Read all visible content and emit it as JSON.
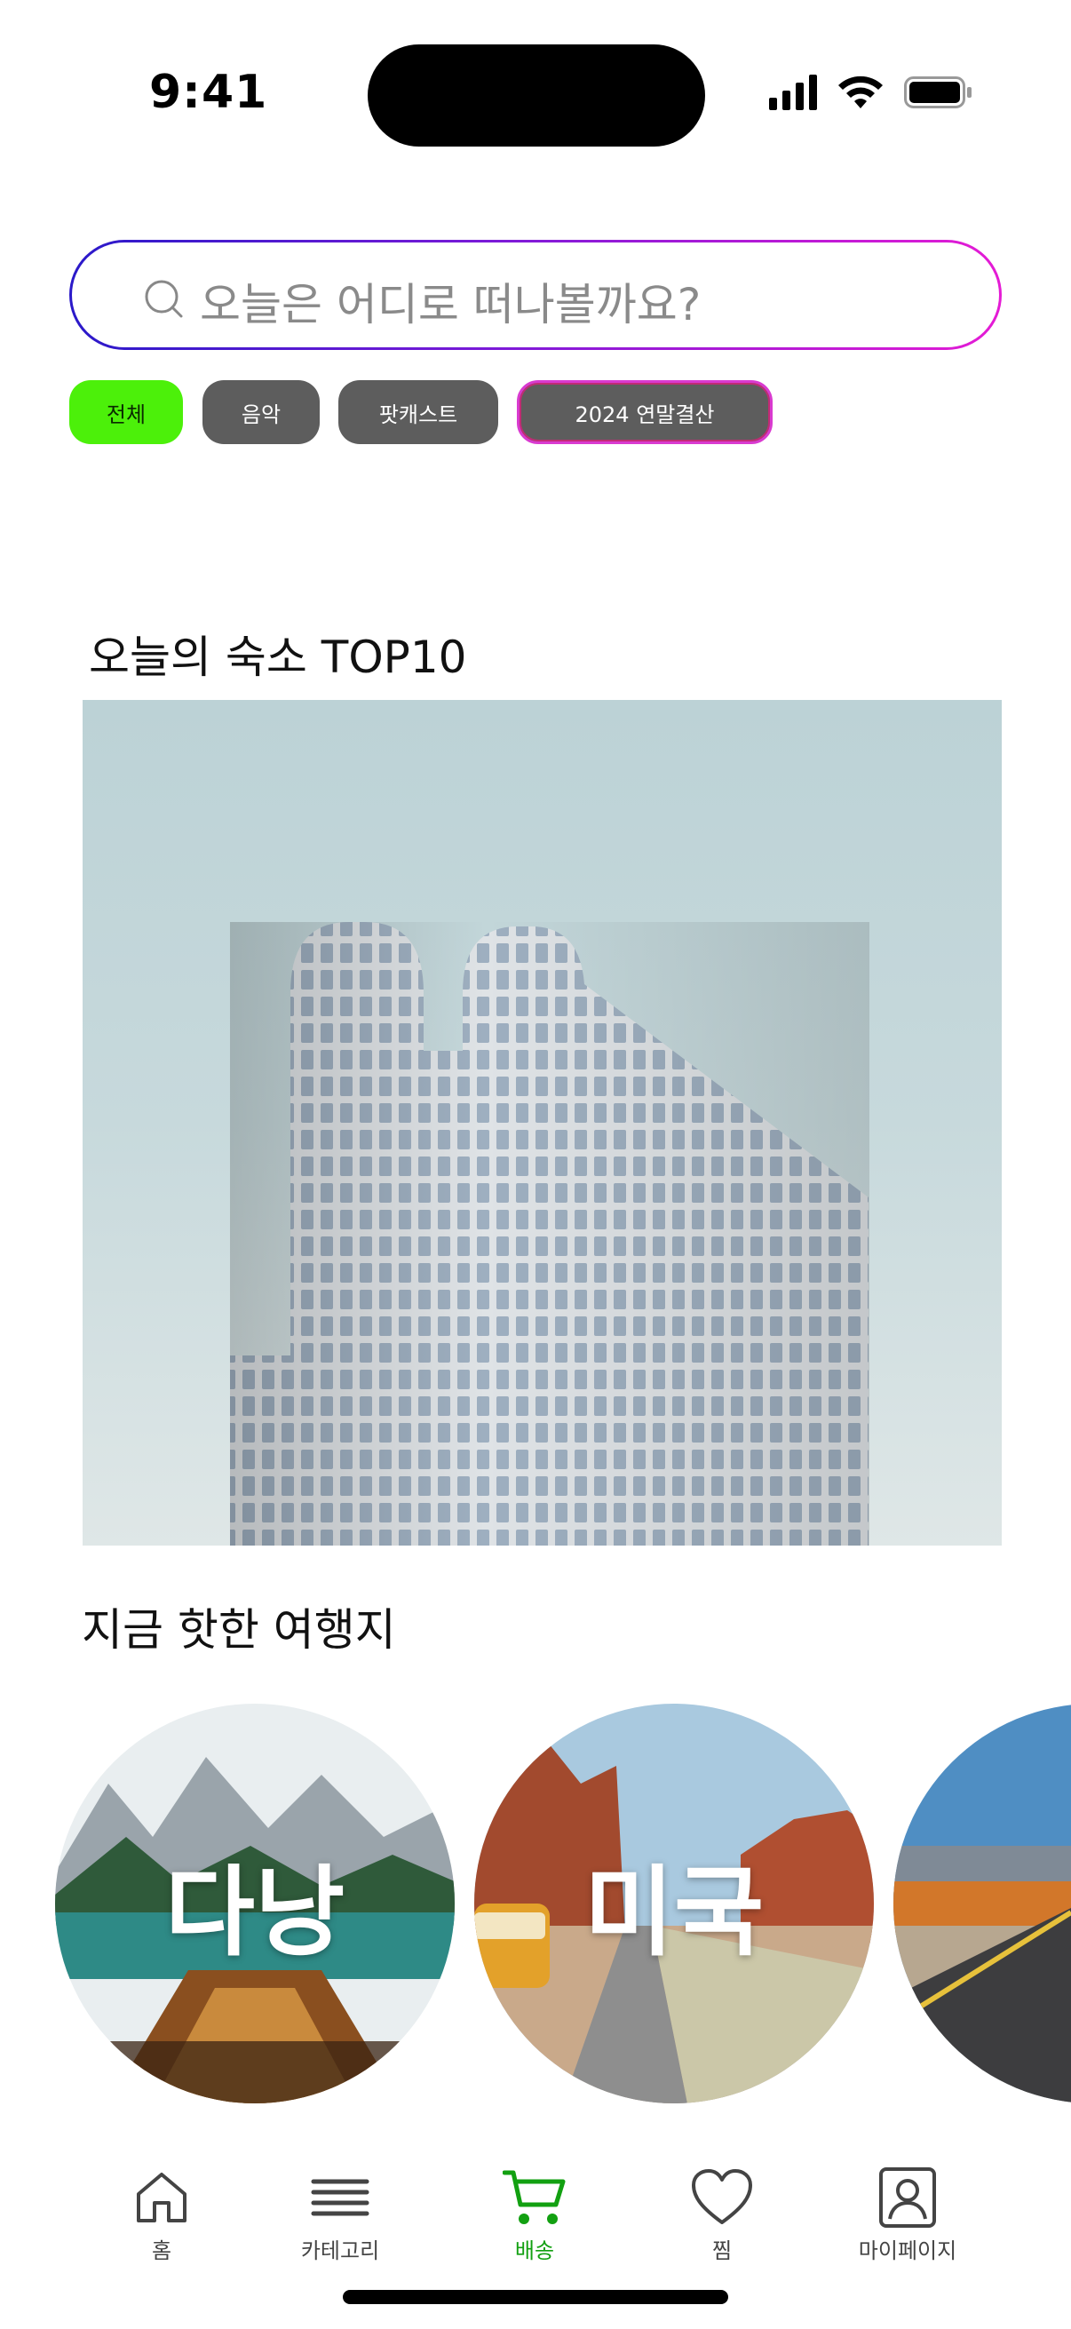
{
  "status_bar": {
    "time": "9:41"
  },
  "search": {
    "placeholder": "오늘은 어디로 떠나볼까요?"
  },
  "chips": [
    {
      "label": "전체",
      "selected": true
    },
    {
      "label": "음악",
      "selected": false
    },
    {
      "label": "팟캐스트",
      "selected": false
    },
    {
      "label": "2024 연말결산",
      "selected": false
    }
  ],
  "sections": {
    "top10_title": "오늘의 숙소 TOP10",
    "hot_title": "지금 핫한 여행지"
  },
  "destinations": [
    {
      "name": "다낭"
    },
    {
      "name": "미국"
    },
    {
      "name": ""
    }
  ],
  "tabbar": {
    "items": [
      {
        "label": "홈",
        "icon": "home-icon"
      },
      {
        "label": "카테고리",
        "icon": "menu-icon"
      },
      {
        "label": "배송",
        "icon": "cart-icon",
        "active": true
      },
      {
        "label": "찜",
        "icon": "heart-icon"
      },
      {
        "label": "마이페이지",
        "icon": "user-icon"
      }
    ]
  },
  "colors": {
    "active_chip": "#4cf00a",
    "chip": "#5d5d5d",
    "tab_active": "#12a011",
    "search_gradient": [
      "#2a19c9",
      "#e51bd5"
    ]
  }
}
